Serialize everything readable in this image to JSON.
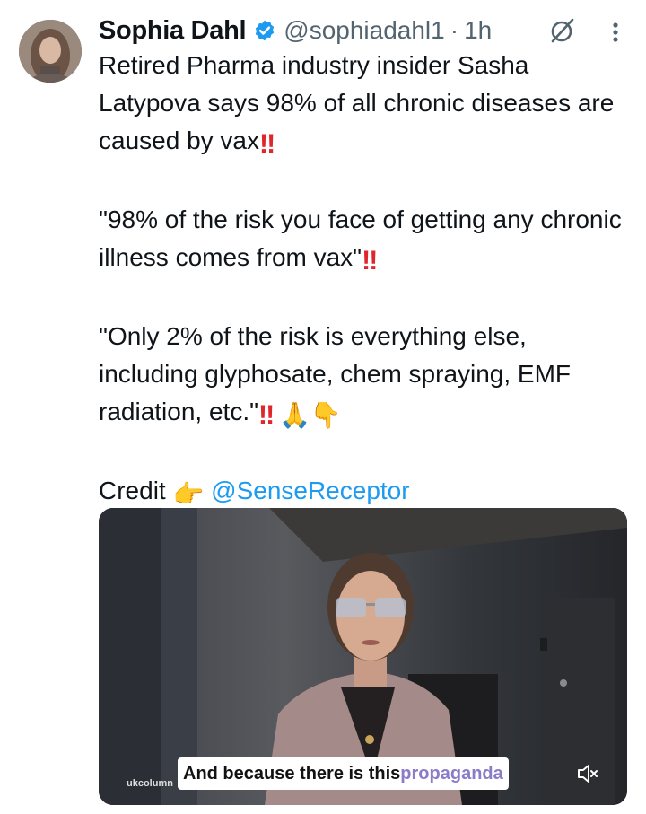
{
  "tweet": {
    "author": {
      "display_name": "Sophia Dahl",
      "handle": "@sophiadahl1",
      "separator": "·",
      "time": "1h",
      "verified": true
    },
    "text": {
      "p1": "Retired Pharma industry insider  Sasha Latypova says 98% of all chronic diseases are caused by vax",
      "p2": "\"98% of the risk you face of getting any chronic illness comes from vax\"",
      "p3": "\"Only 2% of the risk is everything else, including glyphosate, chem spraying, EMF radiation, etc.\"",
      "p4_prefix": "Credit",
      "p4_mention": "@SenseReceptor"
    },
    "emojis": {
      "double_exclamation": "‼",
      "folded_hands": "🙏",
      "pointing_down": "👇",
      "pointing_right": "👉"
    },
    "media": {
      "type": "video",
      "watermark": "ukcolumn",
      "caption_main": "And because there is this ",
      "caption_highlight": "propaganda",
      "muted": true
    }
  },
  "colors": {
    "text": "#0f1419",
    "secondary": "#536471",
    "link": "#1d9bf0",
    "verified": "#1d9bf0",
    "emoji_red": "#e0262b"
  },
  "icons": {
    "verified": "verified-badge-icon",
    "grok": "grok-icon",
    "more": "more-options-icon",
    "mute": "volume-muted-icon"
  }
}
